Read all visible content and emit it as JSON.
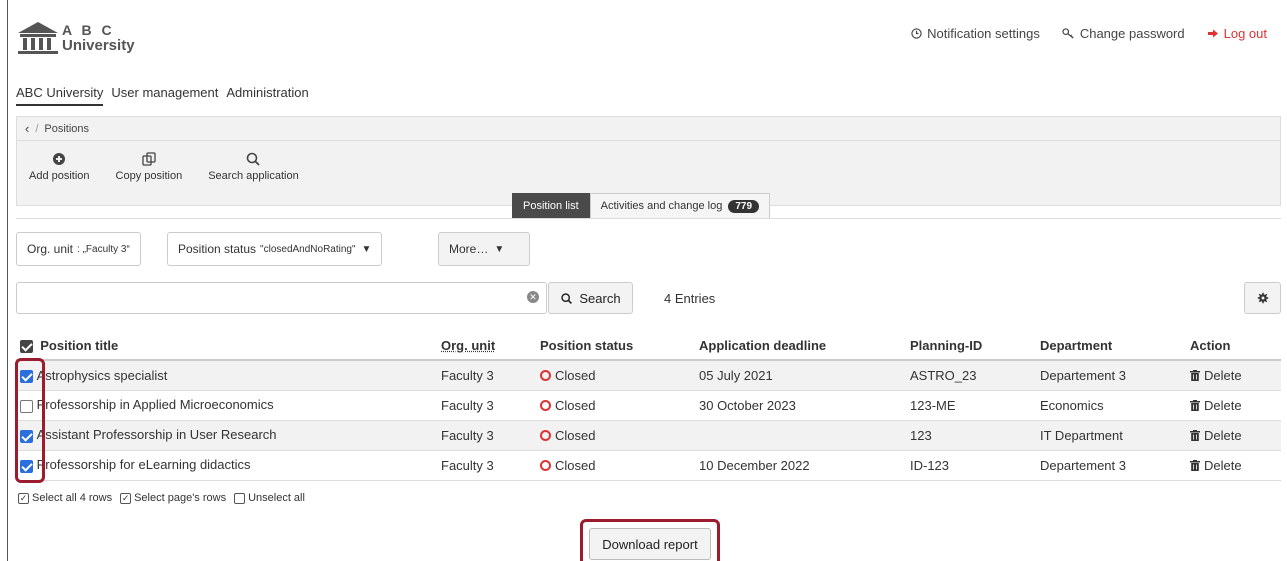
{
  "logo": {
    "line1": "A B C",
    "line2": "University"
  },
  "top_links": {
    "notification": "Notification settings",
    "password": "Change password",
    "logout": "Log out"
  },
  "main_nav": [
    "ABC University",
    "User management",
    "Administration"
  ],
  "breadcrumb": {
    "current": "Positions"
  },
  "toolbar": {
    "add": "Add position",
    "copy": "Copy position",
    "search": "Search application"
  },
  "tabs": {
    "position_list": "Position list",
    "activities": "Activities and change log",
    "activities_count": "779"
  },
  "filters": {
    "org_unit_label": "Org. unit",
    "org_unit_value": ": „Faculty 3“",
    "status_label": "Position status",
    "status_value": "\"closedAndNoRating\"",
    "more": "More…"
  },
  "search": {
    "value": "",
    "button": "Search",
    "entries": "4 Entries"
  },
  "table": {
    "headers": {
      "title": "Position title",
      "org_unit": "Org. unit",
      "status": "Position status",
      "deadline": "Application deadline",
      "planning": "Planning-ID",
      "department": "Department",
      "action": "Action"
    },
    "rows": [
      {
        "checked": true,
        "title": "Astrophysics specialist",
        "org_unit": "Faculty 3",
        "status": "Closed",
        "deadline": "05 July 2021",
        "planning": "ASTRO_23",
        "department": "Departement 3",
        "action": "Delete"
      },
      {
        "checked": false,
        "title": "Professorship in Applied Microeconomics",
        "org_unit": "Faculty 3",
        "status": "Closed",
        "deadline": "30 October 2023",
        "planning": "123-ME",
        "department": "Economics",
        "action": "Delete"
      },
      {
        "checked": true,
        "title": "Assistant Professorship in User Research",
        "org_unit": "Faculty 3",
        "status": "Closed",
        "deadline": "",
        "planning": "123",
        "department": "IT Department",
        "action": "Delete"
      },
      {
        "checked": true,
        "title": "Professorship for eLearning didactics",
        "org_unit": "Faculty 3",
        "status": "Closed",
        "deadline": "10 December 2022",
        "planning": "ID-123",
        "department": "Departement 3",
        "action": "Delete"
      }
    ]
  },
  "selection": {
    "all": "Select all 4 rows",
    "page": "Select page's rows",
    "none": "Unselect all"
  },
  "download": "Download report",
  "colors": {
    "accent": "#2a6fdb",
    "danger": "#d33333",
    "highlight": "#9b1c2e"
  }
}
